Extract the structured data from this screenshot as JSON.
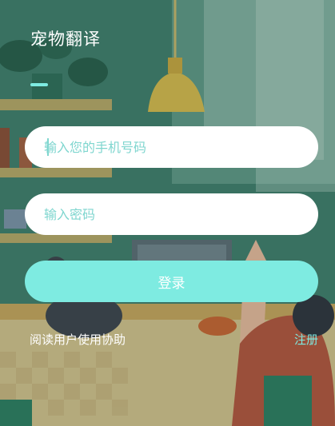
{
  "app": {
    "title": "宠物翻译"
  },
  "login_form": {
    "phone_placeholder": "输入您的手机号码",
    "password_placeholder": "输入密码",
    "login_label": "登录"
  },
  "footer": {
    "agreement_label": "阅读用户使用协助",
    "register_label": "注册"
  },
  "colors": {
    "accent": "#7eebe1",
    "placeholder": "#7fd6cf",
    "background": "#2f6b5c"
  },
  "background": {
    "illustration": "cozy-room-illustration"
  }
}
